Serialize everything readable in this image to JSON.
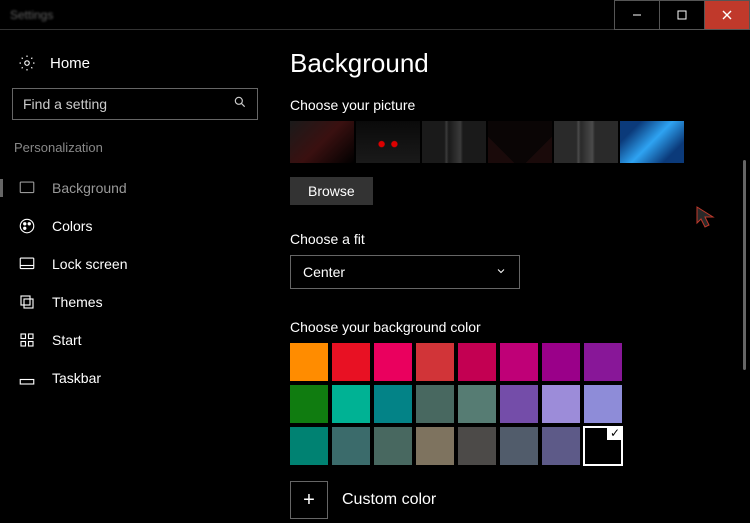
{
  "window": {
    "title": "Settings"
  },
  "sidebar": {
    "home": "Home",
    "search_placeholder": "Find a setting",
    "section": "Personalization",
    "items": [
      "Background",
      "Colors",
      "Lock screen",
      "Themes",
      "Start",
      "Taskbar"
    ],
    "selected_index": 0
  },
  "main": {
    "title": "Background",
    "choose_picture_label": "Choose your picture",
    "browse_label": "Browse",
    "choose_fit_label": "Choose a fit",
    "fit_value": "Center",
    "choose_color_label": "Choose your background color",
    "custom_label": "Custom color",
    "thumbs": [
      {
        "gradient": "linear-gradient(135deg,#1a1a1a,#3a1010,#000)"
      },
      {
        "gradient": "radial-gradient(circle at 40% 55%,#d00 6%,transparent 8%),radial-gradient(circle at 60% 55%,#d00 6%,transparent 8%),linear-gradient(#0a0a0a,#1a1a1a)"
      },
      {
        "gradient": "linear-gradient(90deg,#1a1a1a 35%,#3a3a3a 38%,#1a1a1a 42%,#3a3a3a 60%,#1a1a1a 64%)"
      },
      {
        "gradient": "linear-gradient(45deg,#1a0a0a 25%,transparent 25%),linear-gradient(-45deg,#1a0a0a 25%,transparent 25%),#0a0505"
      },
      {
        "gradient": "linear-gradient(90deg,#2a2a2a 35%,#4a4a4a 38%,#2a2a2a 42%,#4a4a4a 60%,#2a2a2a 64%)"
      },
      {
        "gradient": "linear-gradient(135deg,#0b3a7a 20%,#2ea3f2 50%,#0b3a7a 80%)"
      }
    ],
    "colors_row1": [
      "#ff8c00",
      "#e81123",
      "#ea005e",
      "#d13438",
      "#c30052",
      "#bf0077",
      "#9a0089",
      "#881798"
    ],
    "colors_row2": [
      "#107c10",
      "#00b294",
      "#038387",
      "#486860",
      "#567c73",
      "#744da9",
      "#9c8cd9",
      "#8e8cd8"
    ],
    "colors_row3": [
      "#008272",
      "#3b6b6b",
      "#486860",
      "#7e735f",
      "#4c4a48",
      "#515c6b",
      "#5d5a88",
      "#000000"
    ],
    "selected_color": "#000000"
  }
}
